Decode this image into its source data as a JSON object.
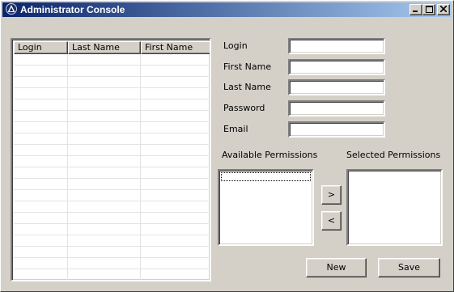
{
  "window": {
    "title": "Administrator Console",
    "app_icon": "triangle-logo-icon",
    "controls": {
      "minimize": "minimize-icon",
      "maximize": "maximize-icon",
      "close": "close-icon"
    }
  },
  "users_table": {
    "columns": [
      "Login",
      "Last Name",
      "First Name"
    ],
    "rows": []
  },
  "form": {
    "login_label": "Login",
    "login_value": "",
    "first_name_label": "First Name",
    "first_name_value": "",
    "last_name_label": "Last Name",
    "last_name_value": "",
    "password_label": "Password",
    "password_value": "",
    "email_label": "Email",
    "email_value": ""
  },
  "permissions": {
    "available_label": "Available Permissions",
    "selected_label": "Selected Permissions",
    "available_items": [],
    "selected_items": [],
    "add_label": ">",
    "remove_label": "<"
  },
  "actions": {
    "new_label": "New",
    "save_label": "Save"
  }
}
